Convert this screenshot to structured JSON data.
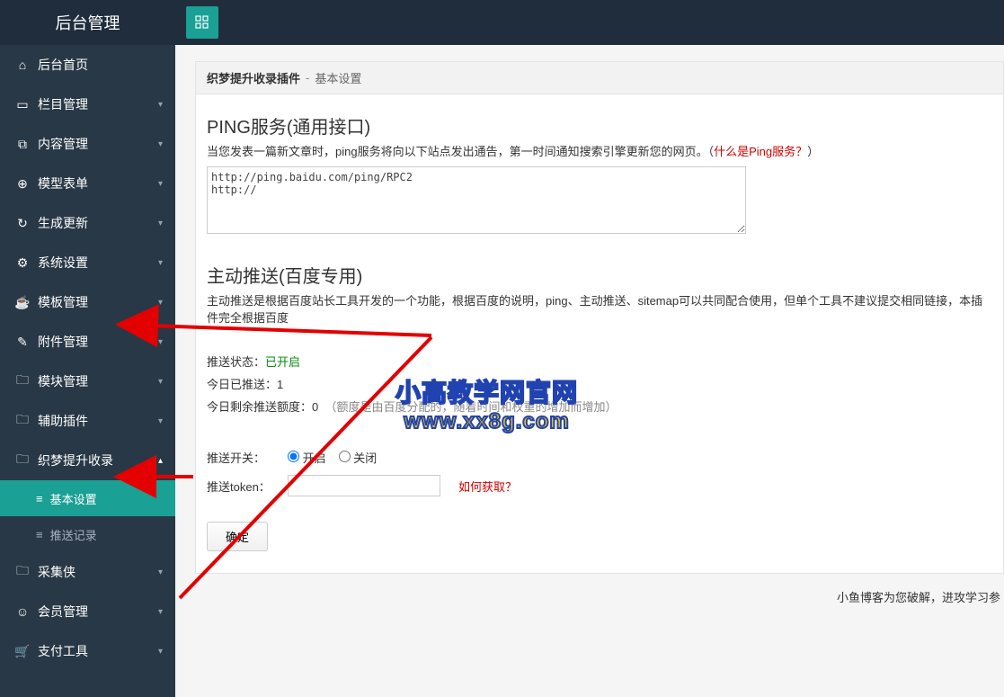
{
  "header": {
    "title": "后台管理"
  },
  "sidebar": {
    "items": [
      {
        "icon": "⌂",
        "label": "后台首页",
        "chevron": ""
      },
      {
        "icon": "▭",
        "label": "栏目管理",
        "chevron": "▾"
      },
      {
        "icon": "⧉",
        "label": "内容管理",
        "chevron": "▾"
      },
      {
        "icon": "⊕",
        "label": "模型表单",
        "chevron": "▾"
      },
      {
        "icon": "↻",
        "label": "生成更新",
        "chevron": "▾"
      },
      {
        "icon": "⚙",
        "label": "系统设置",
        "chevron": "▾"
      },
      {
        "icon": "☕",
        "label": "模板管理",
        "chevron": "▾"
      },
      {
        "icon": "✎",
        "label": "附件管理",
        "chevron": "▾"
      },
      {
        "icon": "🗀",
        "label": "模块管理",
        "chevron": "▾"
      },
      {
        "icon": "🗀",
        "label": "辅助插件",
        "chevron": "▾"
      },
      {
        "icon": "🗀",
        "label": "织梦提升收录",
        "chevron": "▴"
      },
      {
        "icon": "🗀",
        "label": "采集侠",
        "chevron": "▾"
      },
      {
        "icon": "☺",
        "label": "会员管理",
        "chevron": "▾"
      },
      {
        "icon": "🛒",
        "label": "支付工具",
        "chevron": "▾"
      }
    ],
    "subitems": [
      {
        "icon": "≡",
        "label": "基本设置",
        "active": true
      },
      {
        "icon": "≡",
        "label": "推送记录",
        "active": false
      }
    ]
  },
  "breadcrumb": {
    "current": "织梦提升收录插件",
    "sep": "-",
    "page": "基本设置"
  },
  "ping": {
    "title": "PING服务(通用接口)",
    "desc_prefix": "当您发表一篇新文章时，ping服务将向以下站点发出通告，第一时间通知搜索引擎更新您的网页。（",
    "link_text": "什么是Ping服务？",
    "desc_suffix": "）",
    "urls": "http://ping.baidu.com/ping/RPC2\nhttp://"
  },
  "push": {
    "title": "主动推送(百度专用)",
    "desc": "主动推送是根据百度站长工具开发的一个功能，根据百度的说明，ping、主动推送、sitemap可以共同配合使用，但单个工具不建议提交相同链接，本插件完全根据百度",
    "status_label": "推送状态：",
    "status_value": "已开启",
    "today_label": "今日已推送：",
    "today_value": "1",
    "quota_label": "今日剩余推送额度：",
    "quota_value": "0",
    "quota_note": "（额度是由百度分配的，随着时间和权重的增加而增加）",
    "switch_label": "推送开关：",
    "switch_on": "开启",
    "switch_off": "关闭",
    "token_label": "推送token：",
    "token_value": "",
    "howget": "如何获取？",
    "submit": "确定"
  },
  "footer": "小鱼博客为您破解，进攻学习参",
  "watermark": {
    "line1": "小高教学网官网",
    "line2": "www.xx8g.com"
  }
}
